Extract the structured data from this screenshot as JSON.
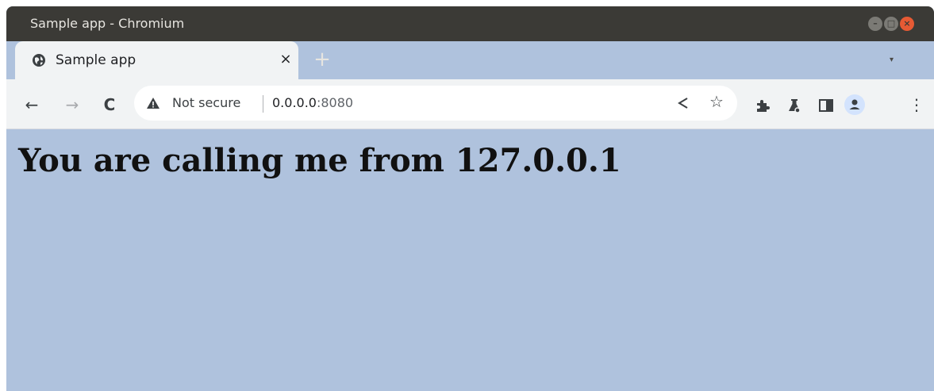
{
  "window": {
    "title": "Sample app - Chromium",
    "controls": {
      "minimize": "–",
      "maximize": "□",
      "close": "×"
    }
  },
  "tab": {
    "title": "Sample app",
    "close": "×",
    "new_tab": "+"
  },
  "toolbar": {
    "back": "←",
    "forward": "→",
    "reload": "C",
    "security_label": "Not secure",
    "url_host": "0.0.0.0",
    "url_port": ":8080",
    "bookmark": "☆",
    "menu": "⋮"
  },
  "page": {
    "heading": "You are calling me from 127.0.0.1"
  },
  "colors": {
    "page_background": "#AFC2DD",
    "titlebar": "#3b3a36",
    "close_button": "#e65a34"
  }
}
